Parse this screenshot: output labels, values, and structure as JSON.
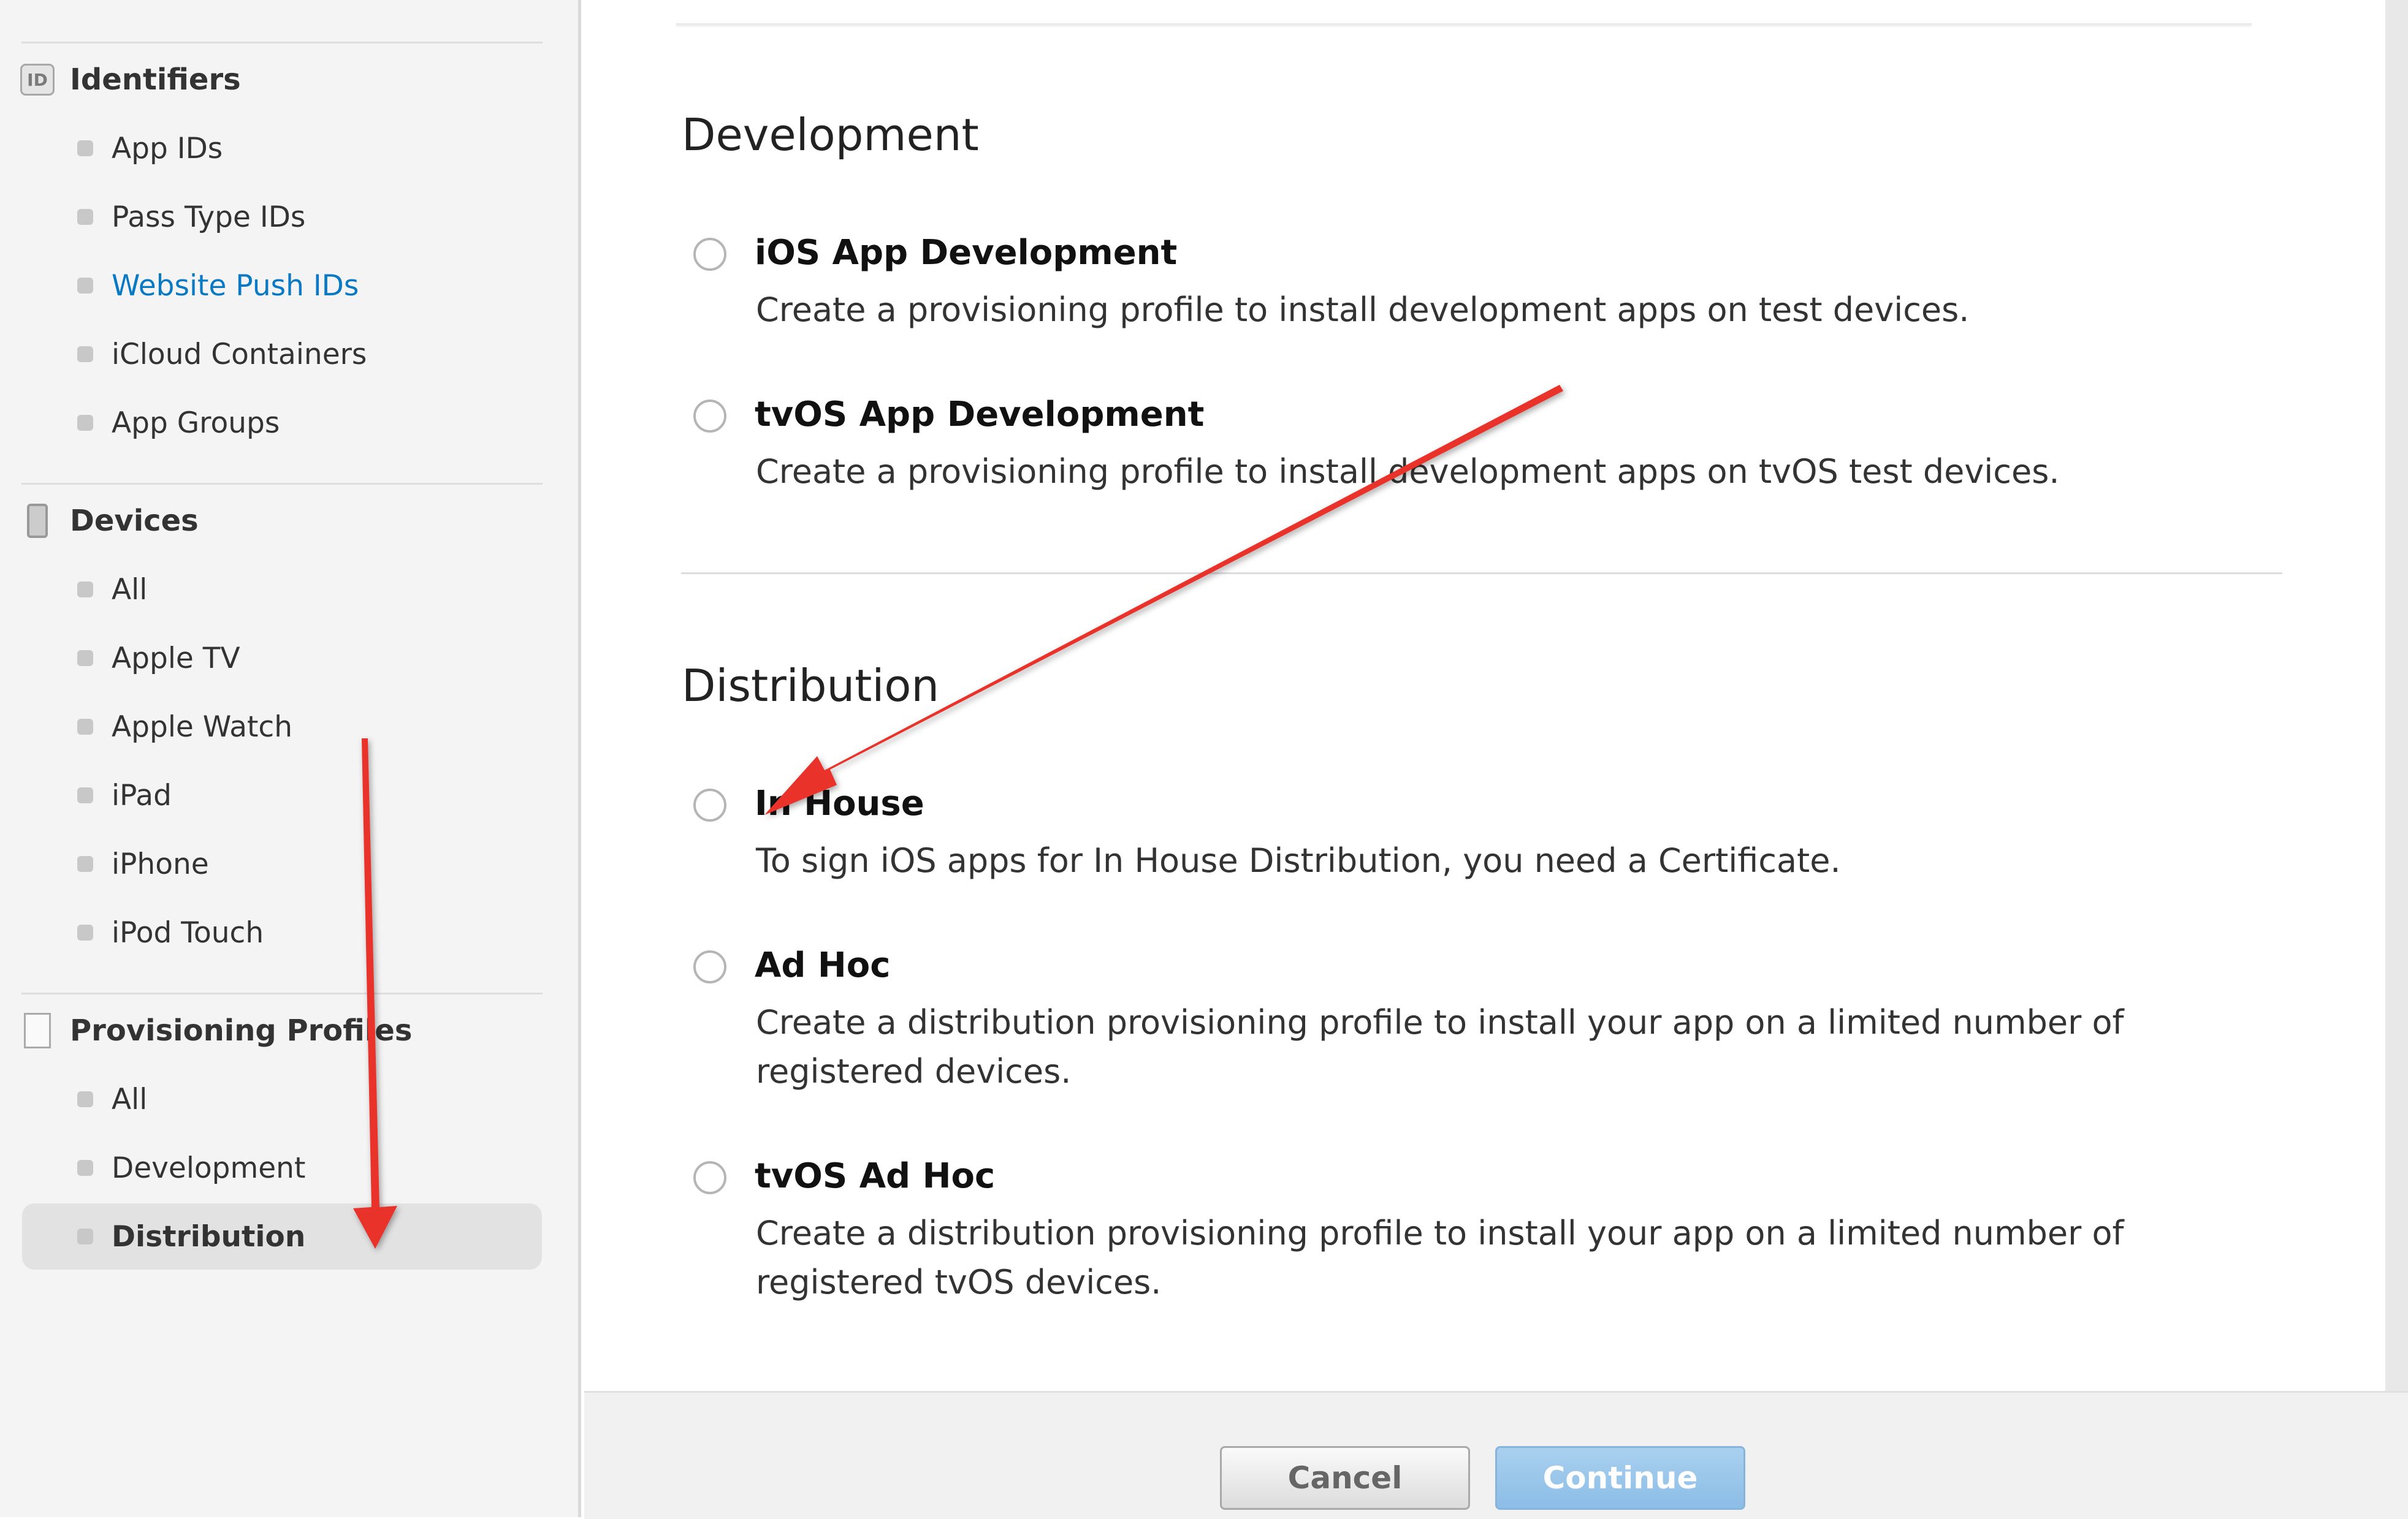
{
  "sidebar": {
    "identifiers": {
      "icon_label": "ID",
      "title": "Identifiers",
      "items": [
        "App IDs",
        "Pass Type IDs",
        "Website Push IDs",
        "iCloud Containers",
        "App Groups"
      ]
    },
    "devices": {
      "title": "Devices",
      "items": [
        "All",
        "Apple TV",
        "Apple Watch",
        "iPad",
        "iPhone",
        "iPod Touch"
      ]
    },
    "provisioning": {
      "title": "Provisioning Profiles",
      "items": [
        "All",
        "Development",
        "Distribution"
      ],
      "selected": "Distribution"
    }
  },
  "main": {
    "development": {
      "title": "Development",
      "options": [
        {
          "title": "iOS App Development",
          "desc": "Create a provisioning profile to install development apps on test devices."
        },
        {
          "title": "tvOS App Development",
          "desc": "Create a provisioning profile to install development apps on tvOS test devices."
        }
      ]
    },
    "distribution": {
      "title": "Distribution",
      "options": [
        {
          "title": "In House",
          "desc": "To sign iOS apps for In House Distribution, you need a Certificate."
        },
        {
          "title": "Ad Hoc",
          "desc": "Create a distribution provisioning profile to install your app on a limited number of registered devices."
        },
        {
          "title": "tvOS Ad Hoc",
          "desc": "Create a distribution provisioning profile to install your app on a limited number of registered tvOS devices."
        }
      ]
    }
  },
  "footer": {
    "cancel_label": "Cancel",
    "continue_label": "Continue"
  },
  "colors": {
    "link": "#0a79c4",
    "annotation_arrow": "#e8312a",
    "continue_button": "#8cbde6"
  }
}
